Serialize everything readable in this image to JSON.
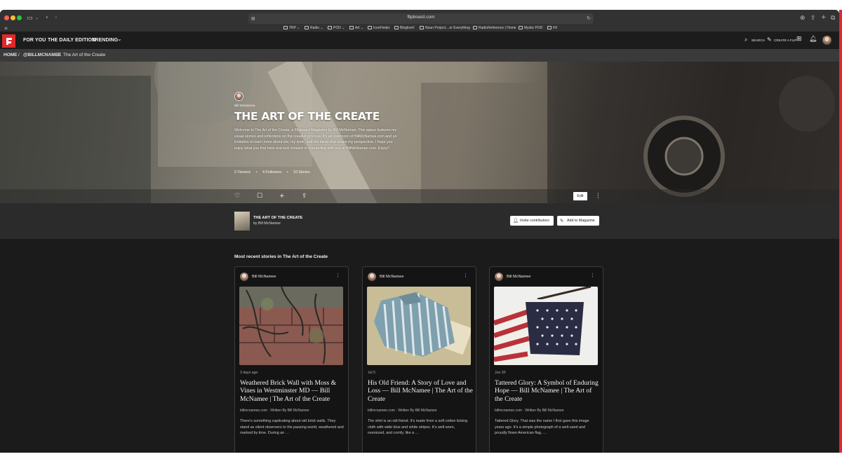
{
  "browser": {
    "url": "flipboard.com",
    "bookmarks": [
      {
        "label": "TRP",
        "icon": "folder-icon"
      },
      {
        "label": "Radio",
        "icon": "folder-icon"
      },
      {
        "label": "POD",
        "icon": "folder-icon"
      },
      {
        "label": "Art",
        "icon": "folder-icon"
      },
      {
        "label": "IconFinder",
        "icon": "bookmark-icon"
      },
      {
        "label": "Bloglovin'",
        "icon": "bookmark-icon"
      },
      {
        "label": "Noun Project:...or Everything",
        "icon": "bookmark-icon"
      },
      {
        "label": "RadioReference | Home",
        "icon": "bookmark-icon"
      },
      {
        "label": "Mystic POD",
        "icon": "bookmark-icon"
      },
      {
        "label": "Hi!",
        "icon": "bookmark-icon"
      }
    ]
  },
  "nav": {
    "items": [
      "FOR YOU",
      "THE DAILY EDITION",
      "TRENDING"
    ],
    "search_label": "SEARCH",
    "create_label": "CREATE A FLIP",
    "brand_color": "#e12828"
  },
  "breadcrumb": {
    "home": "HOME",
    "separator": "/",
    "user": "@BILLMCNAMEE",
    "current": "The Art of the Create"
  },
  "hero": {
    "owner": "Bill McNamee",
    "title": "THE ART OF THE CREATE",
    "description": "Welcome to The Art of the Create, a Flipboard Magazine by Bill McNamee. This space features my visual stories and reflections on the creative process. It's an extension of BillMcNamee.com and an invitation to learn more about me, my work, and the ideas that shape my perspective. I hope you enjoy what you find here and look forward to connecting with you at BillMcNamee.com. Enjoy!!",
    "stats": [
      "2 Viewers",
      "4 Followers",
      "10 Stories"
    ],
    "stat_separator": "•",
    "edit_label": "Edit"
  },
  "magazine": {
    "title": "THE ART OF THE CREATE",
    "byline": "by Bill McNamee",
    "invite_label": "Invite contributors",
    "add_label": "Add to Magazine"
  },
  "stories": {
    "heading": "Most recent stories in The Art of the Create",
    "cards": [
      {
        "author": "Bill McNamee",
        "date": "3 days ago",
        "title": "Weathered Brick Wall with Moss & Vines in Westminster MD — Bill McNamee | The Art of the Create",
        "source": "billmcnamee.com · Written By Bill McNamee",
        "excerpt": "There's something captivating about old brick walls. They stand as silent observers to the passing world, weathered and marked by time. During an …"
      },
      {
        "author": "Bill McNamee",
        "date": "Jul 5",
        "title": "His Old Friend: A Story of Love and Loss — Bill McNamee | The Art of the Create",
        "source": "billmcnamee.com · Written By Bill McNamee",
        "excerpt": "The shirt is an old friend. It's made from a soft cotton ticking cloth with wide blue and white stripes. It's well-worn, oversized, and comfy, like a …"
      },
      {
        "author": "Bill McNamee",
        "date": "Jun 30",
        "title": "Tattered Glory: A Symbol of Enduring Hope — Bill McNamee | The Art of the Create",
        "source": "billmcnamee.com · Written By Bill McNamee",
        "excerpt": "Tattered Glory. That was the name I first gave this image years ago. It's a simple photograph of a well-used and proudly flown American flag, …"
      }
    ]
  }
}
